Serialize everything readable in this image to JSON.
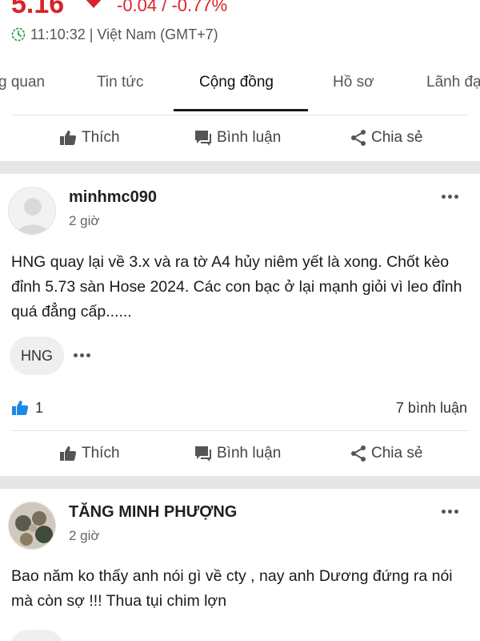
{
  "header": {
    "price": "5.16",
    "change": "-0.04 / -0.77%",
    "time": "11:10:32 | Việt Nam (GMT+7)",
    "accent": "#d8232a"
  },
  "tabs": [
    {
      "label": "g quan",
      "active": false
    },
    {
      "label": "Tin tức",
      "active": false
    },
    {
      "label": "Cộng đồng",
      "active": true
    },
    {
      "label": "Hồ sơ",
      "active": false
    },
    {
      "label": "Lãnh đạ",
      "active": false
    }
  ],
  "actions": {
    "like": "Thích",
    "comment": "Bình luận",
    "share": "Chia sẻ"
  },
  "posts": [
    {
      "author": "minhmc090",
      "time": "2 giờ",
      "text": "HNG quay lại về 3.x và ra tờ A4 hủy niêm yết là xong. Chốt kèo đỉnh 5.73 sàn Hose 2024. Các con bạc ở lại mạnh giỏi vì leo đỉnh quá đẳng cấp......",
      "tag": "HNG",
      "likes": "1",
      "comments": "7 bình luận"
    },
    {
      "author": "TĂNG MINH PHƯỢNG",
      "time": "2 giờ",
      "text": "Bao năm ko thấy anh nói gì về cty , nay anh Dương đứng ra nói mà còn sợ !!! Thua tụi chim lợn"
    }
  ],
  "icons": [
    "clock-icon",
    "thumbs-up-icon",
    "comment-icon",
    "share-icon",
    "more-icon",
    "avatar-placeholder-icon"
  ]
}
